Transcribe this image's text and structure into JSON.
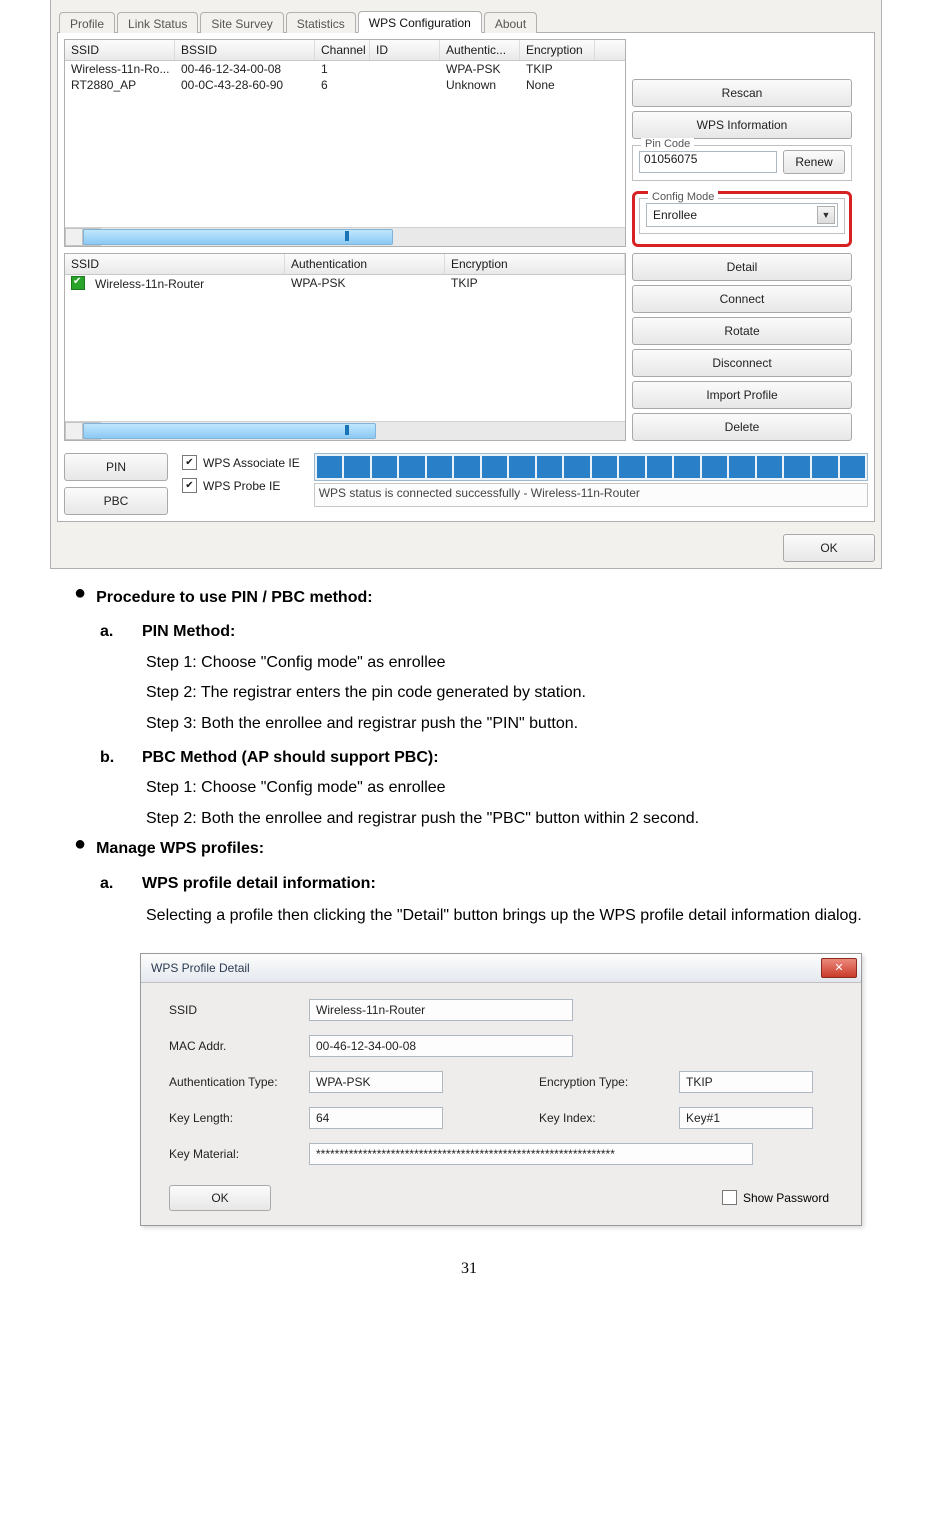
{
  "wps_window": {
    "tabs": [
      "Profile",
      "Link Status",
      "Site Survey",
      "Statistics",
      "WPS Configuration",
      "About"
    ],
    "active_tab_index": 4,
    "top_list": {
      "headers": [
        "SSID",
        "BSSID",
        "Channel",
        "ID",
        "Authentic...",
        "Encryption"
      ],
      "rows": [
        {
          "ssid": "Wireless-11n-Ro...",
          "bssid": "00-46-12-34-00-08",
          "ch": "1",
          "id": "",
          "auth": "WPA-PSK",
          "enc": "TKIP"
        },
        {
          "ssid": "RT2880_AP",
          "bssid": "00-0C-43-28-60-90",
          "ch": "6",
          "id": "",
          "auth": "Unknown",
          "enc": "None"
        }
      ]
    },
    "side": {
      "rescan": "Rescan",
      "wps_info": "WPS Information",
      "pin_code_legend": "Pin Code",
      "pin_code_value": "01056075",
      "renew": "Renew",
      "config_mode_legend": "Config Mode",
      "config_mode_value": "Enrollee"
    },
    "bottom_list": {
      "headers": [
        "SSID",
        "Authentication",
        "Encryption"
      ],
      "rows": [
        {
          "ssid": "Wireless-11n-Router",
          "auth": "WPA-PSK",
          "enc": "TKIP",
          "checked": true
        }
      ]
    },
    "side_btns": [
      "Detail",
      "Connect",
      "Rotate",
      "Disconnect",
      "Import Profile",
      "Delete"
    ],
    "pin_btn": "PIN",
    "pbc_btn": "PBC",
    "chk_assoc": "WPS Associate IE",
    "chk_probe": "WPS Probe IE",
    "status_text": "WPS status is connected successfully - Wireless-11n-Router",
    "ok": "OK"
  },
  "doc": {
    "head1": "Procedure to use PIN / PBC method:",
    "a_label": "a.",
    "a_title": "PIN Method:",
    "a_steps": [
      "Step 1: Choose \"Config mode\" as enrollee",
      "Step 2: The registrar enters the pin code generated by station.",
      "Step 3: Both the enrollee and registrar push the \"PIN\" button."
    ],
    "b_label": "b.",
    "b_title": "PBC Method (AP should support PBC):",
    "b_steps": [
      "Step 1: Choose \"Config mode\" as enrollee",
      "Step 2: Both the enrollee and registrar push the \"PBC\" button within 2 second."
    ],
    "head2": "Manage WPS profiles:",
    "c_label": "a.",
    "c_title": "WPS profile detail information:",
    "c_body": "Selecting a profile then clicking the \"Detail\" button brings up the WPS profile detail information dialog."
  },
  "detail_dialog": {
    "title": "WPS Profile Detail",
    "labels": {
      "ssid": "SSID",
      "mac": "MAC Addr.",
      "authtype": "Authentication Type:",
      "enctype": "Encryption Type:",
      "keylen": "Key Length:",
      "keyidx": "Key Index:",
      "keymat": "Key Material:"
    },
    "values": {
      "ssid": "Wireless-11n-Router",
      "mac": "00-46-12-34-00-08",
      "authtype": "WPA-PSK",
      "enctype": "TKIP",
      "keylen": "64",
      "keyidx": "Key#1",
      "keymat": "****************************************************************"
    },
    "ok": "OK",
    "show_pw": "Show Password"
  },
  "page_number": "31"
}
